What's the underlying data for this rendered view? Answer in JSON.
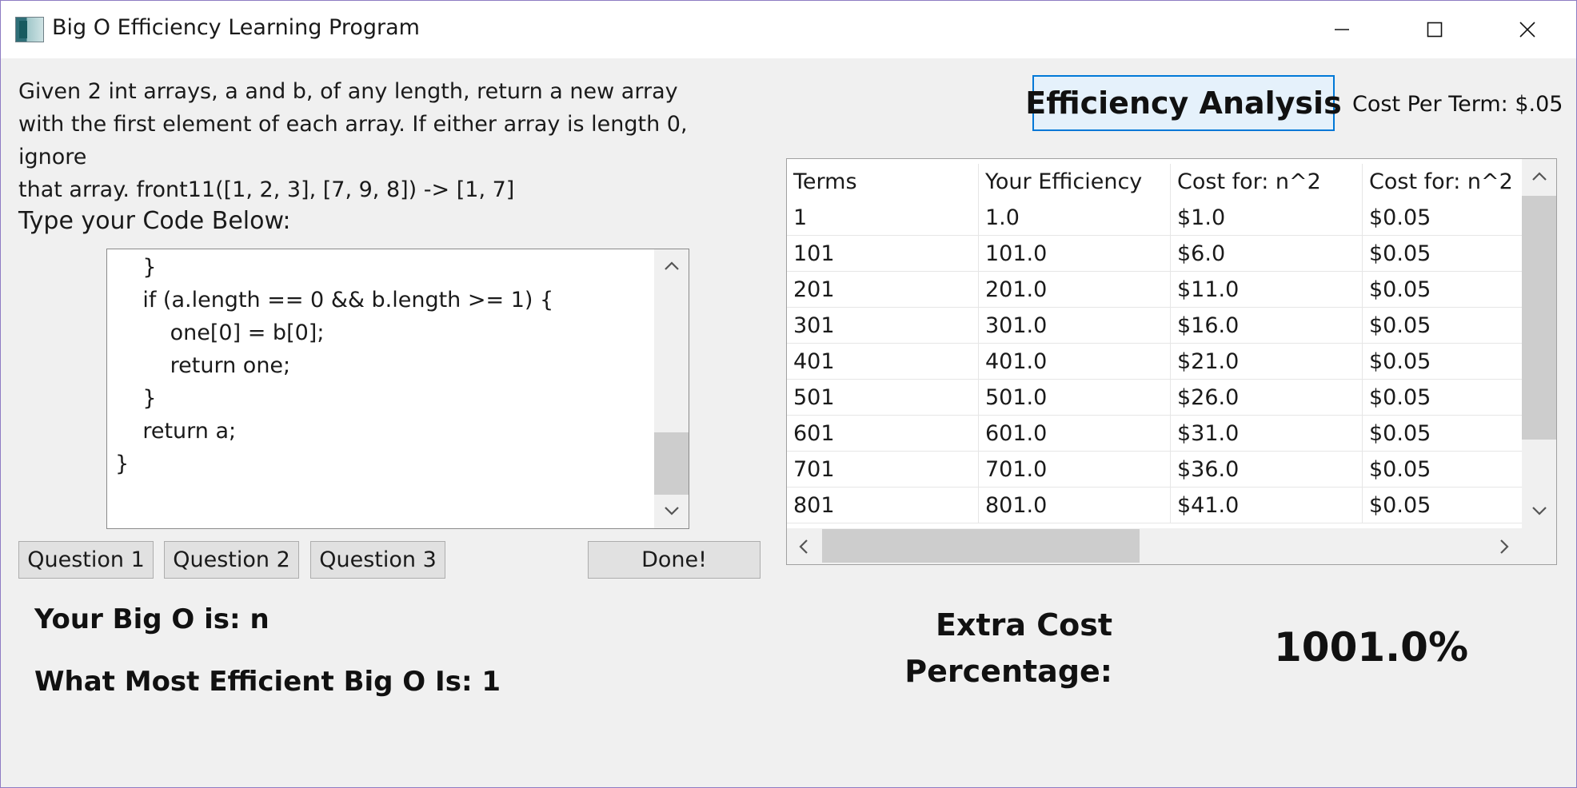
{
  "window": {
    "title": "Big O Efficiency Learning Program",
    "controls": [
      "minimize",
      "maximize",
      "close"
    ]
  },
  "problem": {
    "lines": [
      "Given 2 int arrays, a and b, of any length, return a new array",
      "with the first element of each array. If either array is length 0, ignore",
      "that array. front11([1, 2, 3], [7, 9, 8]) -> [1, 7]"
    ]
  },
  "code_editor": {
    "label": "Type your Code Below:",
    "lines": [
      "    }",
      "    if (a.length == 0 && b.length >= 1) {",
      "        one[0] = b[0];",
      "        return one;",
      "    }",
      "    return a;",
      "}"
    ]
  },
  "buttons": {
    "question1": "Question 1",
    "question2": "Question 2",
    "question3": "Question 3",
    "done": "Done!"
  },
  "results": {
    "your_big_o": "Your Big O is: n",
    "most_efficient": "What Most Efficient Big O Is: 1"
  },
  "analysis": {
    "button_label": "Efficiency Analysis",
    "cost_per_term": "Cost Per Term: $.05"
  },
  "table": {
    "headers": [
      "Terms",
      "Your Efficiency",
      "Cost for: n^2",
      "Cost for: n^2"
    ],
    "rows": [
      [
        "1",
        "1.0",
        "$1.0",
        "$0.05"
      ],
      [
        "101",
        "101.0",
        "$6.0",
        "$0.05"
      ],
      [
        "201",
        "201.0",
        "$11.0",
        "$0.05"
      ],
      [
        "301",
        "301.0",
        "$16.0",
        "$0.05"
      ],
      [
        "401",
        "401.0",
        "$21.0",
        "$0.05"
      ],
      [
        "501",
        "501.0",
        "$26.0",
        "$0.05"
      ],
      [
        "601",
        "601.0",
        "$31.0",
        "$0.05"
      ],
      [
        "701",
        "701.0",
        "$36.0",
        "$0.05"
      ],
      [
        "801",
        "801.0",
        "$41.0",
        "$0.05"
      ]
    ]
  },
  "extra_cost": {
    "label_line1": "Extra Cost",
    "label_line2": "Percentage:",
    "value": "1001.0%"
  }
}
